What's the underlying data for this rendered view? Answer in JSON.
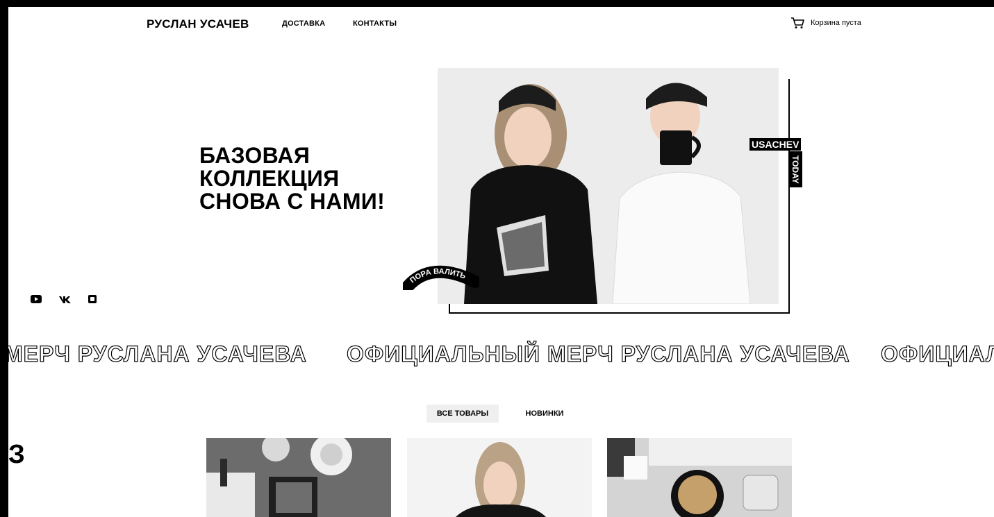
{
  "header": {
    "logo": "РУСЛАН УСАЧЕВ",
    "nav": [
      "ДОСТАВКА",
      "КОНТАКТЫ"
    ],
    "cart_label": "Корзина пуста"
  },
  "hero": {
    "title_lines": [
      "БАЗОВАЯ",
      "КОЛЛЕКЦИЯ",
      "СНОВА С НАМИ!"
    ],
    "badge_usachev": "USACHEV",
    "badge_today": "TODAY",
    "sticker": "ПОРА ВАЛИТЬ"
  },
  "social": [
    "youtube-icon",
    "vk-icon",
    "instagram-icon"
  ],
  "marquee": {
    "items": [
      "МЕРЧ РУСЛАНА УСАЧЕВА",
      "ОФИЦИАЛЬНЫЙ МЕРЧ РУСЛАНА УСАЧЕВА",
      "ОФИЦИАЛ"
    ]
  },
  "tabs": [
    "ВСЕ ТОВАРЫ",
    "НОВИНКИ"
  ],
  "edge_char": "З"
}
